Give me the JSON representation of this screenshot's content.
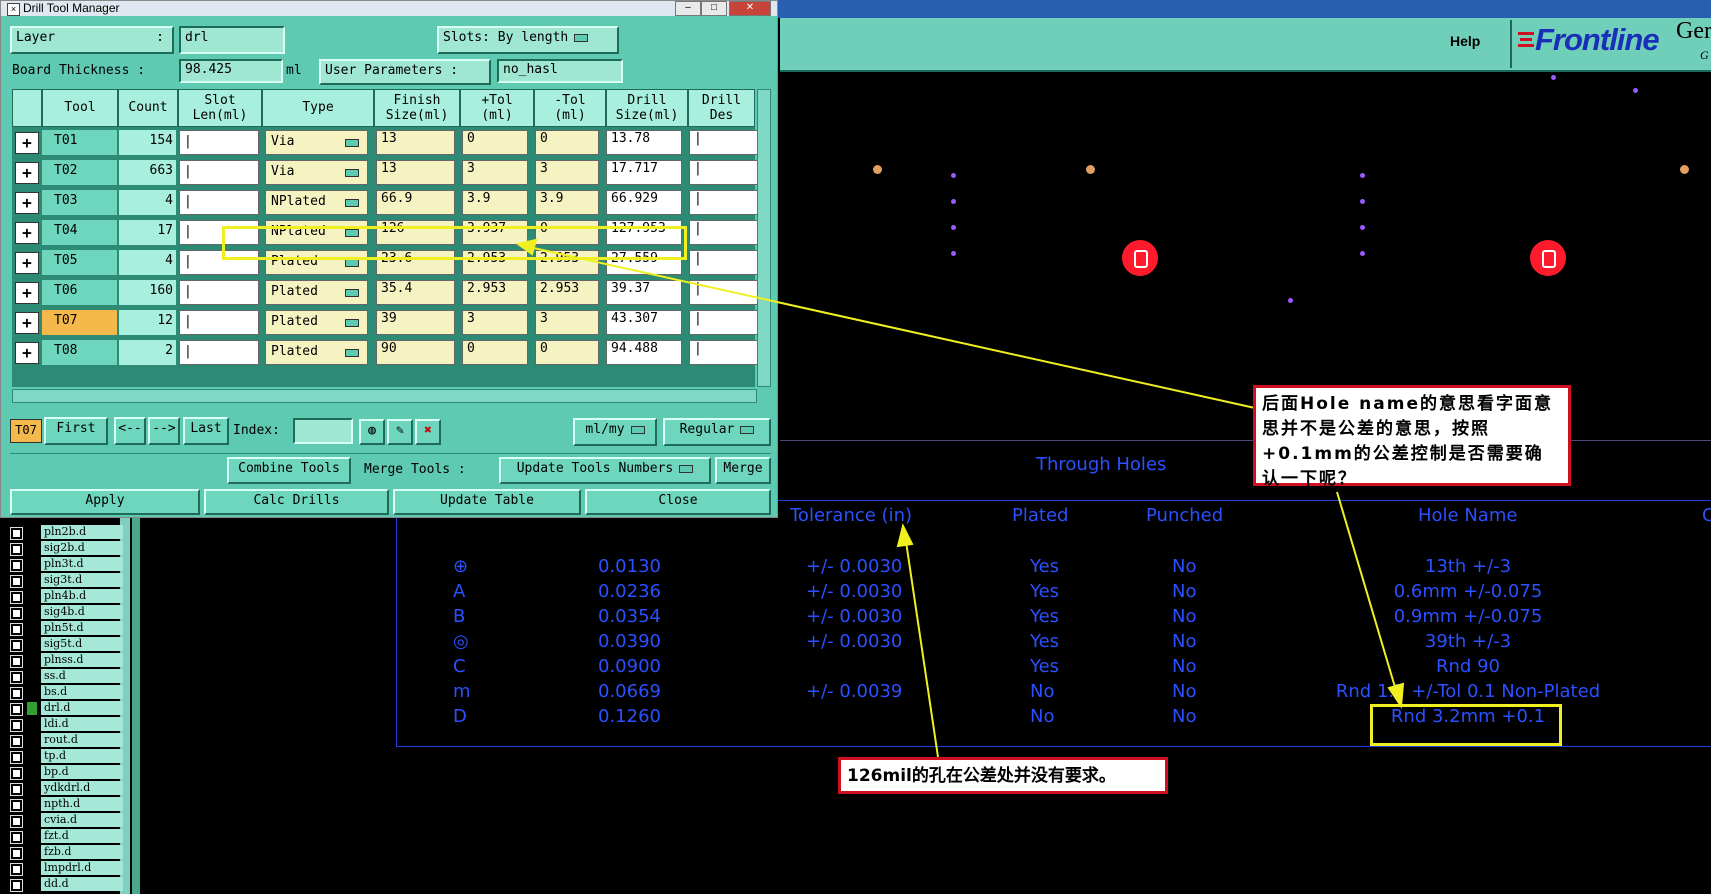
{
  "window": {
    "title": "Drill Tool Manager",
    "fields": {
      "layer_label": "Layer",
      "layer_value": "drl",
      "slots_label": "Slots:",
      "slots_value": "By length",
      "thickness_label": "Board Thickness :",
      "thickness_value": "98.425",
      "thickness_unit": "ml",
      "user_params_label": "User Parameters :",
      "user_params_value": "no_hasl"
    },
    "table": {
      "headers": [
        "Tool",
        "Count",
        "Slot\nLen(ml)",
        "Type",
        "Finish\nSize(ml)",
        "+Tol\n(ml)",
        "-Tol\n(ml)",
        "Drill\nSize(ml)",
        "Drill\nDes"
      ],
      "rows": [
        {
          "tool": "T01",
          "count": "154",
          "type": "Via",
          "finish": "13",
          "ptol": "0",
          "mtol": "0",
          "drill": "13.78"
        },
        {
          "tool": "T02",
          "count": "663",
          "type": "Via",
          "finish": "13",
          "ptol": "3",
          "mtol": "3",
          "drill": "17.717"
        },
        {
          "tool": "T03",
          "count": "4",
          "type": "NPlated",
          "finish": "66.9",
          "ptol": "3.9",
          "mtol": "3.9",
          "drill": "66.929"
        },
        {
          "tool": "T04",
          "count": "17",
          "type": "NPlated",
          "finish": "126",
          "ptol": "3.937",
          "mtol": "0",
          "drill": "127.953"
        },
        {
          "tool": "T05",
          "count": "4",
          "type": "Plated",
          "finish": "23.6",
          "ptol": "2.953",
          "mtol": "2.953",
          "drill": "27.559"
        },
        {
          "tool": "T06",
          "count": "160",
          "type": "Plated",
          "finish": "35.4",
          "ptol": "2.953",
          "mtol": "2.953",
          "drill": "39.37"
        },
        {
          "tool": "T07",
          "count": "12",
          "type": "Plated",
          "finish": "39",
          "ptol": "3",
          "mtol": "3",
          "drill": "43.307"
        },
        {
          "tool": "T08",
          "count": "2",
          "type": "Plated",
          "finish": "90",
          "ptol": "0",
          "mtol": "0",
          "drill": "94.488"
        }
      ]
    },
    "nav": {
      "current": "T07",
      "first": "First",
      "prev": "<--",
      "next": "-->",
      "last": "Last",
      "index_label": "Index:",
      "units": "ml/my",
      "mode": "Regular"
    },
    "tools_row": {
      "combine": "Combine Tools",
      "merge_label": "Merge Tools :",
      "update_numbers": "Update Tools Numbers",
      "merge": "Merge"
    },
    "bottom": {
      "apply": "Apply",
      "calc": "Calc Drills",
      "update_table": "Update Table",
      "close": "Close"
    }
  },
  "app": {
    "help": "Help",
    "logo": "Frontline",
    "logo_ger": "Ger",
    "logo_g": "G"
  },
  "layers": [
    "pln2b.d",
    "sig2b.d",
    "pln3t.d",
    "sig3t.d",
    "pln4b.d",
    "sig4b.d",
    "pln5t.d",
    "sig5t.d",
    "plnss.d",
    "ss.d",
    "bs.d",
    "drl.d",
    "ldi.d",
    "rout.d",
    "tp.d",
    "bp.d",
    "ydkdrl.d",
    "npth.d",
    "cvia.d",
    "fzt.d",
    "fzb.d",
    "lmpdrl.d",
    "dd.d"
  ],
  "drill_chart": {
    "section_title": "Through Holes",
    "headers": {
      "tolerance": "Tolerance (in)",
      "plated": "Plated",
      "punched": "Punched",
      "hole_name": "Hole Name",
      "cut": "C"
    },
    "rows": [
      {
        "sym": "⊕",
        "size": "0.0130",
        "tol": "+/- 0.0030",
        "plated": "Yes",
        "punched": "No",
        "name": "13th +/-3"
      },
      {
        "sym": "A",
        "size": "0.0236",
        "tol": "+/- 0.0030",
        "plated": "Yes",
        "punched": "No",
        "name": "0.6mm +/-0.075"
      },
      {
        "sym": "B",
        "size": "0.0354",
        "tol": "+/- 0.0030",
        "plated": "Yes",
        "punched": "No",
        "name": "0.9mm +/-0.075"
      },
      {
        "sym": "◎",
        "size": "0.0390",
        "tol": "+/- 0.0030",
        "plated": "Yes",
        "punched": "No",
        "name": "39th +/-3"
      },
      {
        "sym": "C",
        "size": "0.0900",
        "tol": "",
        "plated": "Yes",
        "punched": "No",
        "name": "Rnd 90"
      },
      {
        "sym": "m",
        "size": "0.0669",
        "tol": "+/- 0.0039",
        "plated": "No",
        "punched": "No",
        "name": "Rnd 1.7 +/-Tol 0.1 Non-Plated"
      },
      {
        "sym": "D",
        "size": "0.1260",
        "tol": "",
        "plated": "No",
        "punched": "No",
        "name": "Rnd 3.2mm +0.1"
      }
    ]
  },
  "annotations": {
    "note1": "后面Hole name的意思看字面意思并不是公差的意思，按照+0.1mm的公差控制是否需要确认一下呢？",
    "note2": "126mil的孔在公差处并没有要求。"
  },
  "colors": {
    "panel": "#5fcab2",
    "selected_tool": "#f5b84a",
    "chart_text": "#2b50ff",
    "annotation_border": "#d01020",
    "highlight": "#f0f020"
  }
}
